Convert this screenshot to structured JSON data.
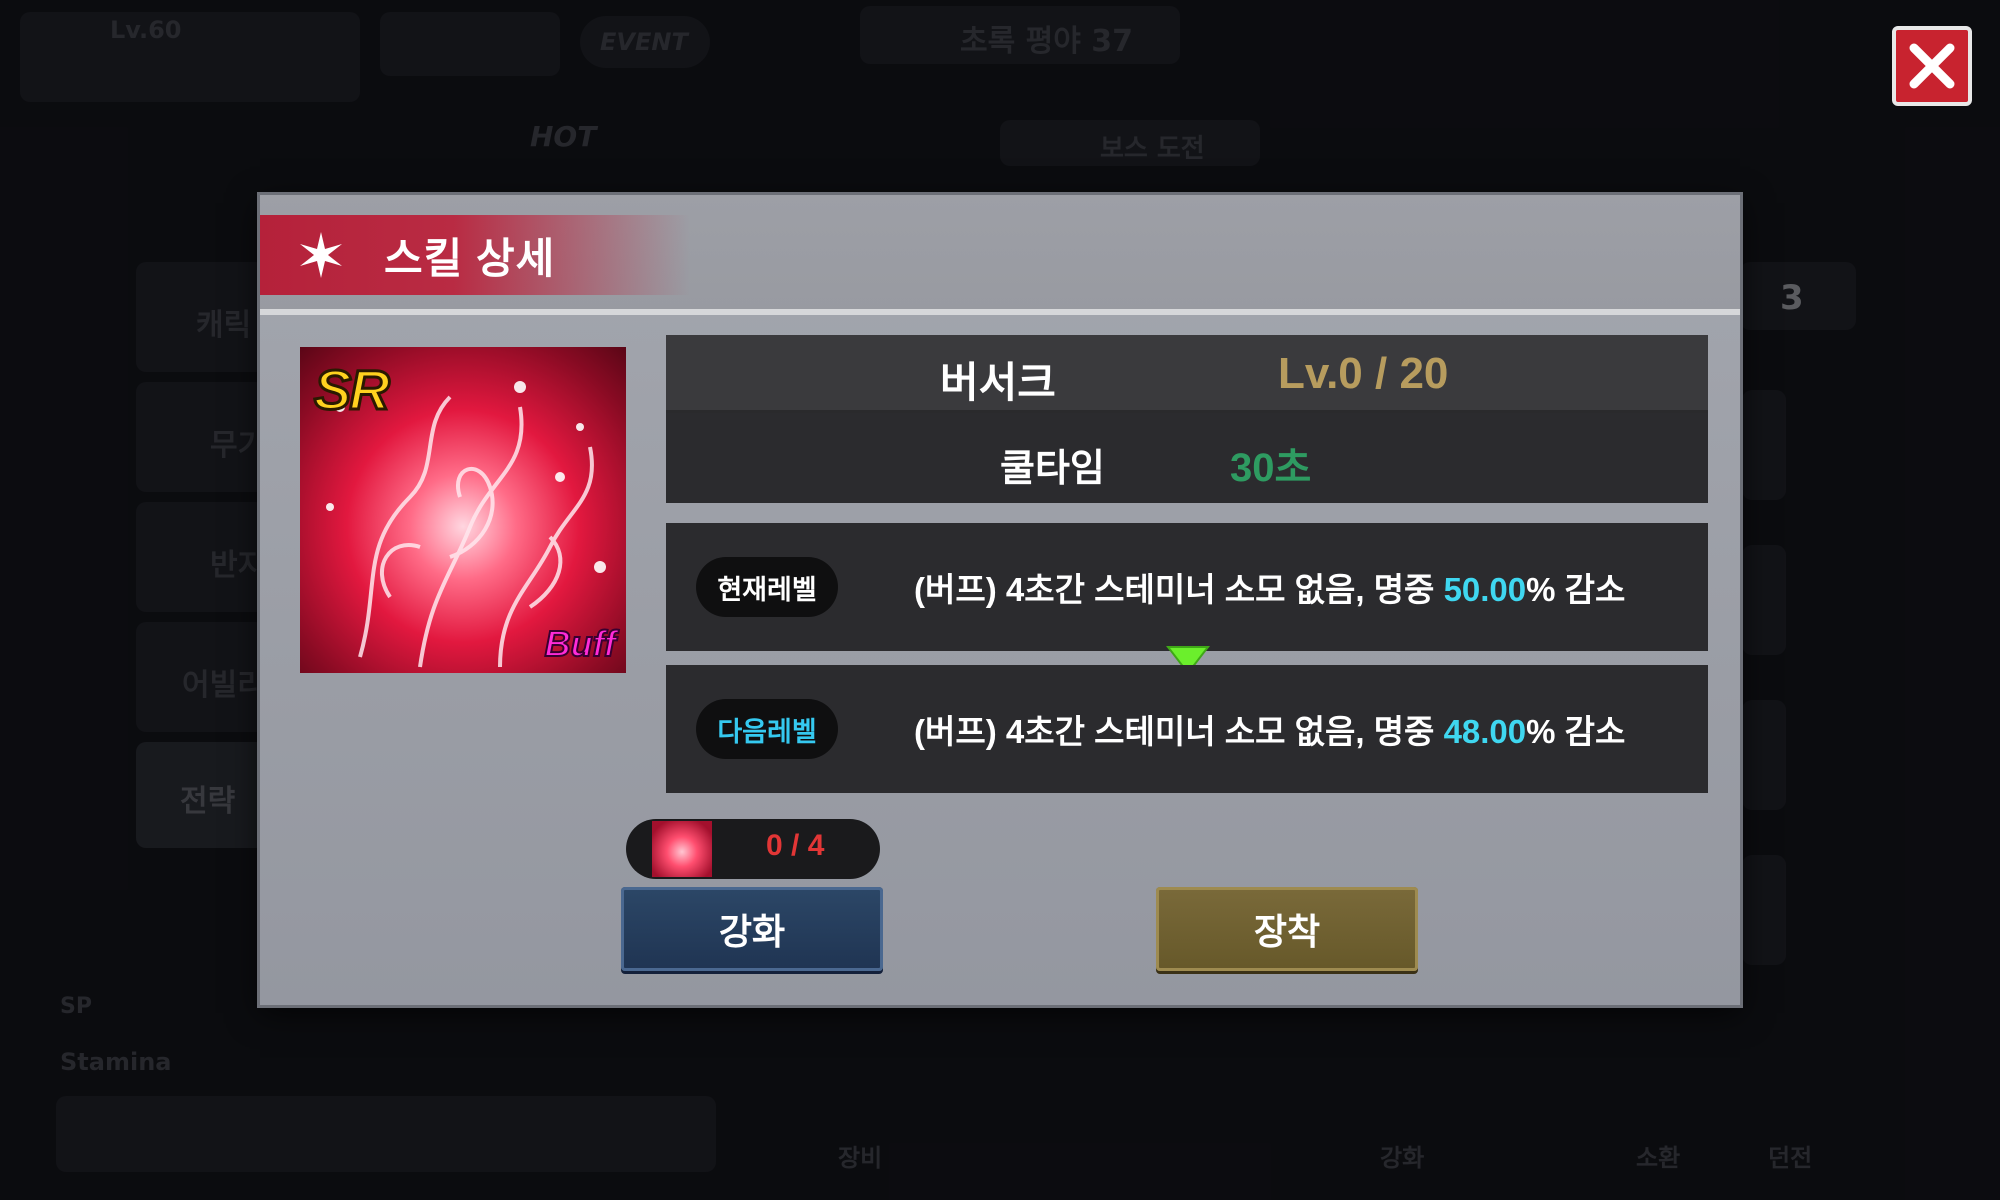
{
  "colors": {
    "header_band": "#b5213a",
    "level_text": "#b79c5e",
    "cooldown_text": "#2e9b61",
    "highlight_value": "#3fd7f0",
    "next_level_pill_text": "#35c9f0",
    "material_count": "#e23636",
    "upgrade_button": "#1f3452",
    "equip_button": "#665829",
    "close_button": "#c8232f"
  },
  "background": {
    "player_level": "Lv.60",
    "event_label": "EVENT",
    "stage_title": "초록 평야 37",
    "hot_label": "HOT",
    "menu_strategy": "전략",
    "menu_ability": "어빌리",
    "menu_armor": "무기",
    "menu_ring": "반지",
    "menu_character": "캐릭",
    "stamina_label": "Stamina",
    "sp_label": "SP",
    "boss_challenge": "보스 도전",
    "side_count": "3",
    "bottom_equip": "장비",
    "bottom_upgrade": "강화",
    "bottom_summon": "소환",
    "bottom_dungeon": "던전"
  },
  "modal": {
    "title_icon": "sparkle-icon",
    "title": "스킬 상세",
    "skill": {
      "rarity": "SR",
      "type_badge": "Buff",
      "name": "버서크",
      "level": "Lv.0 / 20",
      "cooldown_label": "쿨타임",
      "cooldown_value": "30초"
    },
    "current_level": {
      "label": "현재레벨",
      "desc_prefix": "(버프) 4초간 스테미너 소모 없음, 명중 ",
      "value": "50.00",
      "desc_suffix": "% 감소"
    },
    "next_level": {
      "label": "다음레벨",
      "desc_prefix": "(버프) 4초간 스테미너 소모 없음, 명중 ",
      "value": "48.00",
      "desc_suffix": "% 감소"
    },
    "material_count": "0 / 4",
    "upgrade_button": "강화",
    "equip_button": "장착"
  },
  "close_icon": "close-icon"
}
